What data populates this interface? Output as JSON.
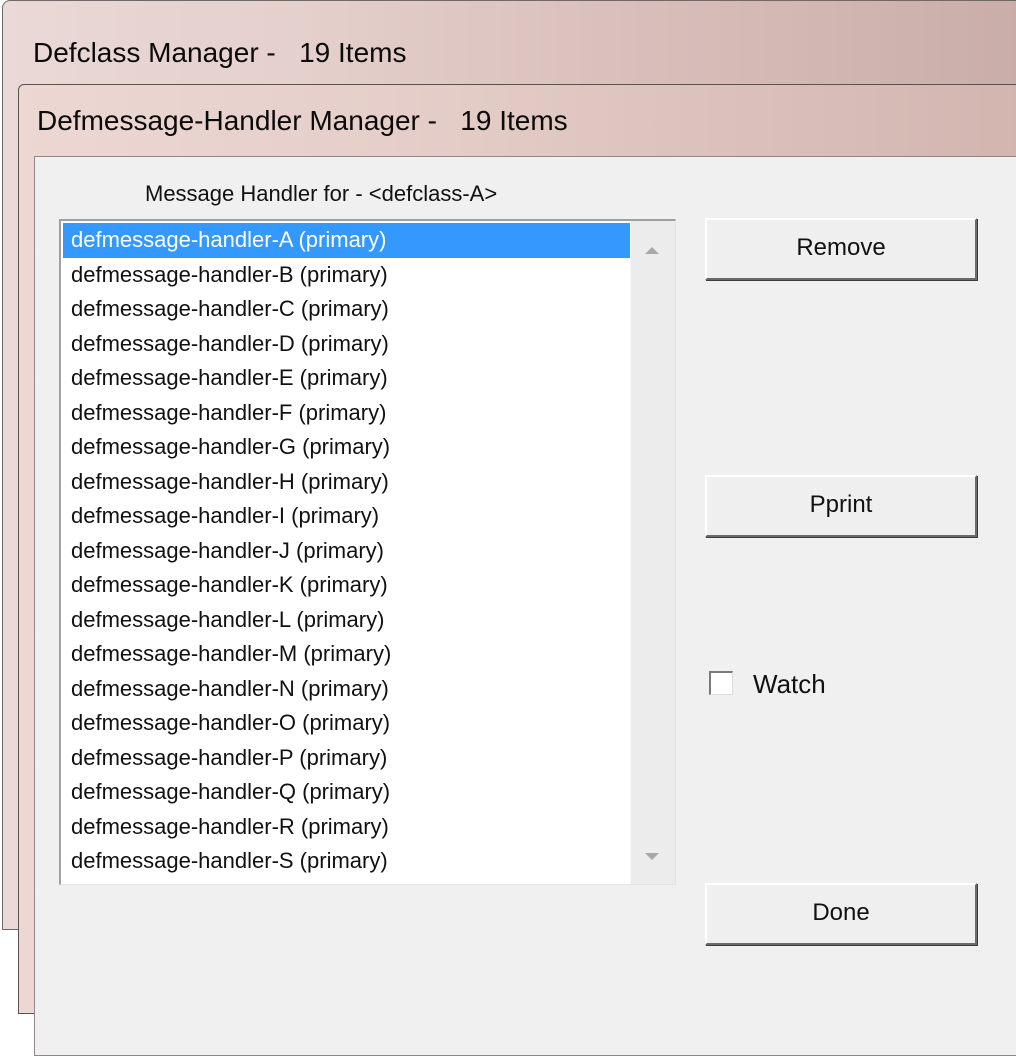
{
  "back_window": {
    "title": "Defclass Manager -   19 Items"
  },
  "front_window": {
    "title": "Defmessage-Handler Manager -   19 Items"
  },
  "dialog": {
    "caption": "Message Handler for - <defclass-A>",
    "items": [
      "defmessage-handler-A (primary)",
      "defmessage-handler-B (primary)",
      "defmessage-handler-C (primary)",
      "defmessage-handler-D (primary)",
      "defmessage-handler-E (primary)",
      "defmessage-handler-F (primary)",
      "defmessage-handler-G (primary)",
      "defmessage-handler-H (primary)",
      "defmessage-handler-I (primary)",
      "defmessage-handler-J (primary)",
      "defmessage-handler-K (primary)",
      "defmessage-handler-L (primary)",
      "defmessage-handler-M (primary)",
      "defmessage-handler-N (primary)",
      "defmessage-handler-O (primary)",
      "defmessage-handler-P (primary)",
      "defmessage-handler-Q (primary)",
      "defmessage-handler-R (primary)",
      "defmessage-handler-S (primary)"
    ],
    "selected_item": "defmessage-handler-A (primary)",
    "remove_label": "Remove",
    "pprint_label": "Pprint",
    "watch_label": "Watch",
    "watch_checked": false,
    "done_label": "Done"
  },
  "colors": {
    "selection": "#3399ff",
    "dialog_face": "#f0f0f0"
  }
}
